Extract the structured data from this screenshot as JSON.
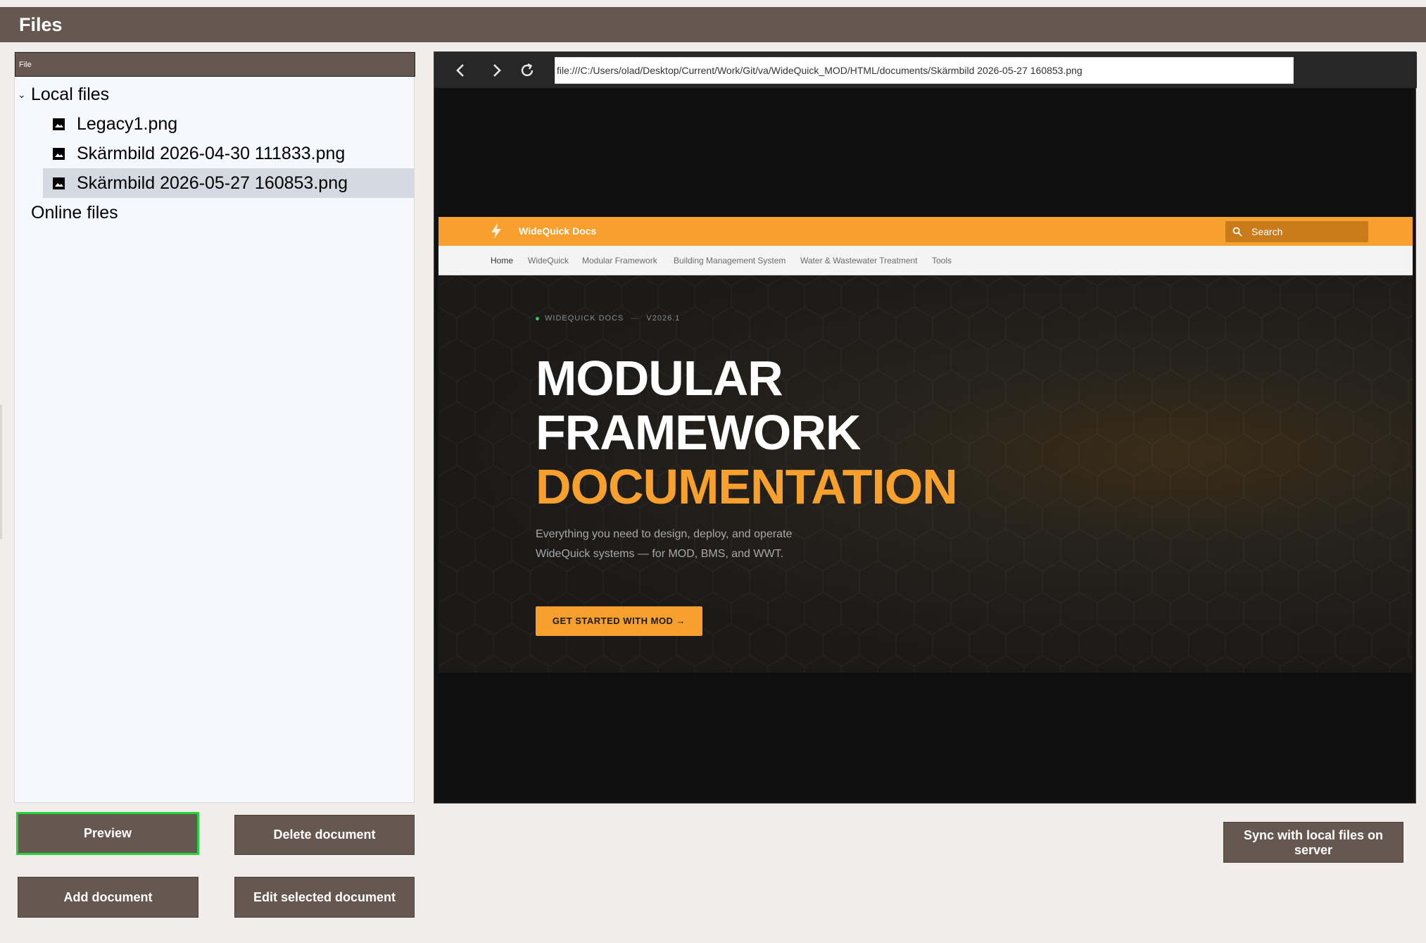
{
  "window": {
    "title": "Files"
  },
  "tree": {
    "header": "File",
    "local_group": "Local files",
    "local_files": [
      "Legacy1.png",
      "Skärmbild 2026-04-30 111833.png",
      "Skärmbild 2026-05-27 160853.png"
    ],
    "selected_index": 2,
    "online_group": "Online files"
  },
  "preview": {
    "url": "file:///C:/Users/olad/Desktop/Current/Work/Git/va/WideQuick_MOD/HTML/documents/Skärmbild 2026-05-27 160853.png",
    "nav_icons": [
      "back-arrow-icon",
      "forward-arrow-icon",
      "refresh-icon"
    ],
    "site": {
      "brand": "WideQuick Docs",
      "accent_color": "#f7a02d",
      "search_placeholder": "Search",
      "subnav": [
        "Home",
        "WideQuick",
        "Modular Framework",
        "Building Management System",
        "Water & Wastewater Treatment",
        "Tools"
      ],
      "eyebrow_label": "WIDEQUICK DOCS",
      "eyebrow_sep": "—",
      "eyebrow_version": "V2026.1",
      "heading_line1": "MODULAR",
      "heading_line2": "FRAMEWORK",
      "heading_line3": "DOCUMENTATION",
      "description": "Everything you need to design, deploy, and operate WideQuick systems — for MOD, BMS, and WWT.",
      "cta": "GET STARTED WITH MOD →"
    }
  },
  "buttons": {
    "preview": "Preview",
    "delete": "Delete document",
    "add": "Add document",
    "edit": "Edit selected document",
    "sync": "Sync with local files on server"
  },
  "colors": {
    "chrome": "#665850",
    "focus_ring": "#22d33a",
    "background": "#f1edea"
  }
}
